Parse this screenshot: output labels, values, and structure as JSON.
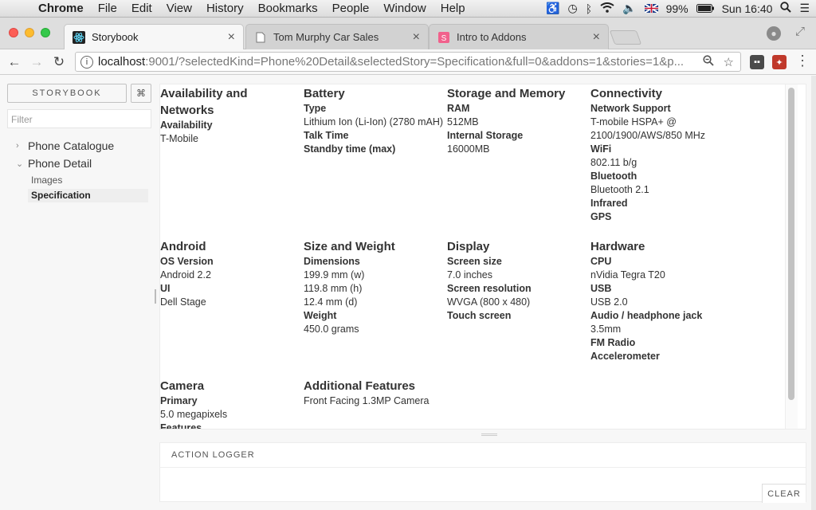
{
  "menubar": {
    "apple": "",
    "app": "Chrome",
    "items": [
      "File",
      "Edit",
      "View",
      "History",
      "Bookmarks",
      "People",
      "Window",
      "Help"
    ],
    "battery": "99%",
    "clock": "Sun 16:40"
  },
  "tabs": [
    {
      "title": "Storybook",
      "close": "×"
    },
    {
      "title": "Tom Murphy Car Sales",
      "close": "×"
    },
    {
      "title": "Intro to Addons",
      "close": "×"
    }
  ],
  "toolbar": {
    "url_host": "localhost",
    "url_rest": ":9001/?selectedKind=Phone%20Detail&selectedStory=Specification&full=0&addons=1&stories=1&p..."
  },
  "sidebar": {
    "header": "STORYBOOK",
    "shortcuts": "⌘",
    "filter_placeholder": "Filter",
    "kinds": [
      {
        "label": "Phone Catalogue",
        "arrow": "›"
      },
      {
        "label": "Phone Detail",
        "arrow": "⌄"
      }
    ],
    "stories": [
      {
        "label": "Images"
      },
      {
        "label": "Specification"
      }
    ]
  },
  "spec": {
    "availability": {
      "title": "Availability and Networks",
      "items": [
        {
          "label": "Availability",
          "values": [
            "T-Mobile"
          ]
        }
      ]
    },
    "battery": {
      "title": "Battery",
      "items": [
        {
          "label": "Type",
          "values": [
            "Lithium Ion (Li-Ion) (2780 mAH)"
          ]
        },
        {
          "label": "Talk Time",
          "values": []
        },
        {
          "label": "Standby time (max)",
          "values": []
        }
      ]
    },
    "storage": {
      "title": "Storage and Memory",
      "items": [
        {
          "label": "RAM",
          "values": [
            "512MB"
          ]
        },
        {
          "label": "Internal Storage",
          "values": [
            "16000MB"
          ]
        }
      ]
    },
    "connectivity": {
      "title": "Connectivity",
      "items": [
        {
          "label": "Network Support",
          "values": [
            "T-mobile HSPA+ @",
            "2100/1900/AWS/850 MHz"
          ]
        },
        {
          "label": "WiFi",
          "values": [
            "802.11 b/g"
          ]
        },
        {
          "label": "Bluetooth",
          "values": [
            "Bluetooth 2.1"
          ]
        },
        {
          "label": "Infrared",
          "values": []
        },
        {
          "label": "GPS",
          "values": []
        }
      ]
    },
    "android": {
      "title": "Android",
      "items": [
        {
          "label": "OS Version",
          "values": [
            "Android 2.2"
          ]
        },
        {
          "label": "UI",
          "values": [
            "Dell Stage"
          ]
        }
      ]
    },
    "size": {
      "title": "Size and Weight",
      "items": [
        {
          "label": "Dimensions",
          "values": [
            "199.9 mm (w)",
            "119.8 mm (h)",
            "12.4 mm (d)"
          ]
        },
        {
          "label": "Weight",
          "values": [
            "450.0 grams"
          ]
        }
      ]
    },
    "display": {
      "title": "Display",
      "items": [
        {
          "label": "Screen size",
          "values": [
            "7.0 inches"
          ]
        },
        {
          "label": "Screen resolution",
          "values": [
            "WVGA (800 x 480)"
          ]
        },
        {
          "label": "Touch screen",
          "values": []
        }
      ]
    },
    "hardware": {
      "title": "Hardware",
      "items": [
        {
          "label": "CPU",
          "values": [
            "nVidia Tegra T20"
          ]
        },
        {
          "label": "USB",
          "values": [
            "USB 2.0"
          ]
        },
        {
          "label": "Audio / headphone jack",
          "values": [
            "3.5mm"
          ]
        },
        {
          "label": "FM Radio",
          "values": []
        },
        {
          "label": "Accelerometer",
          "values": []
        }
      ]
    },
    "camera": {
      "title": "Camera",
      "items": [
        {
          "label": "Primary",
          "values": [
            "5.0 megapixels"
          ]
        },
        {
          "label": "Features",
          "values": []
        }
      ]
    },
    "additional": {
      "title": "Additional Features",
      "items": [
        {
          "label": "",
          "values": [
            "Front Facing 1.3MP Camera"
          ]
        }
      ]
    }
  },
  "logger": {
    "title": "ACTION LOGGER",
    "clear": "CLEAR"
  }
}
